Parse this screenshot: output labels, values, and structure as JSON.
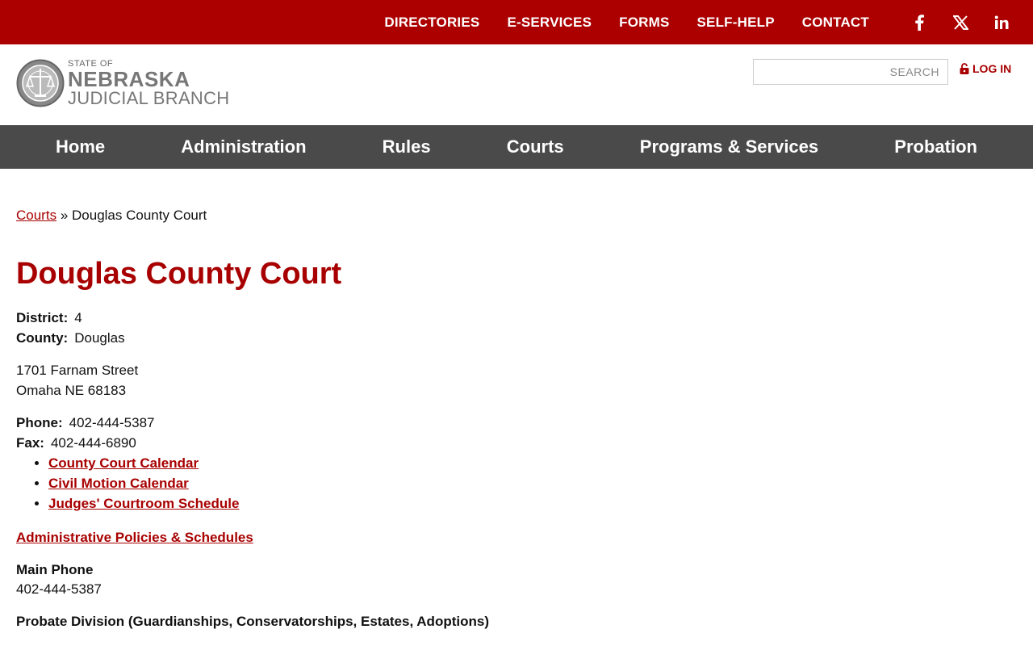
{
  "topnav": [
    "DIRECTORIES",
    "E-SERVICES",
    "FORMS",
    "SELF-HELP",
    "CONTACT"
  ],
  "social": {
    "facebook": "facebook-icon",
    "x": "x-icon",
    "linkedin": "linkedin-icon"
  },
  "logo": {
    "line1": "STATE OF",
    "line2": "NEBRASKA",
    "line3": "JUDICIAL BRANCH"
  },
  "search": {
    "placeholder": "SEARCH"
  },
  "login": {
    "label": "LOG IN"
  },
  "mainnav": [
    "Home",
    "Administration",
    "Rules",
    "Courts",
    "Programs & Services",
    "Probation"
  ],
  "breadcrumb": {
    "link": "Courts",
    "sep": "»",
    "current": "Douglas County Court"
  },
  "page": {
    "title": "Douglas County Court",
    "district_label": "District:",
    "district": "4",
    "county_label": "County:",
    "county": "Douglas",
    "address1": "1701 Farnam Street",
    "address2": "Omaha NE 68183",
    "phone_label": "Phone:",
    "phone": "402-444-5387",
    "fax_label": "Fax:",
    "fax": "402-444-6890",
    "links": [
      "County Court Calendar",
      "Civil Motion Calendar",
      "Judges' Courtroom Schedule"
    ],
    "admin_link": "Administrative Policies & Schedules",
    "main_phone_label": "Main Phone",
    "main_phone": "402-444-5387",
    "probate_label": "Probate Division (Guardianships, Conservatorships, Estates, Adoptions)"
  },
  "colors": {
    "brand_red": "#ac0000",
    "nav_gray": "#4a4a4a",
    "link_red": "#a80000"
  }
}
